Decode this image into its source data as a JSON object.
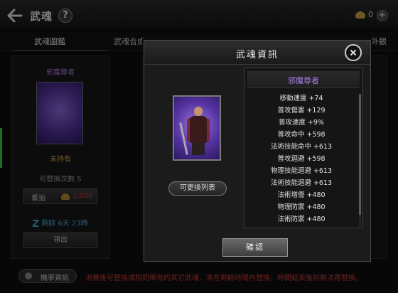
{
  "screen": {
    "title": "武魂",
    "help_label": "?",
    "currency_value": "0",
    "plus_label": "+"
  },
  "tabs": [
    {
      "label": "武魂圖鑑"
    },
    {
      "label": "武魂合成"
    },
    {
      "label": "外觀"
    }
  ],
  "left_panel": {
    "name": "邪魔尊者",
    "status": "未持有",
    "swap_count": "可替換次數 5",
    "redraw_label": "重抽",
    "redraw_cost": "1,000",
    "timer": "剩餘 6天 23時",
    "claim_label": "領出"
  },
  "bottom": {
    "probability_label": "機率資訊",
    "notice": "消費後可替換成相同稀有的其它武魂，未在剩餘時間內替換，時間結束後則無法再替換。"
  },
  "dialog": {
    "title": "武魂資訊",
    "list_button": "可更換列表",
    "confirm": "確認",
    "soul_name": "邪魔尊者",
    "stats": [
      {
        "name": "移動速度",
        "value": "+74"
      },
      {
        "name": "普攻傷害",
        "value": "+129"
      },
      {
        "name": "普攻速度",
        "value": "+9%"
      },
      {
        "name": "普攻命中",
        "value": "+598"
      },
      {
        "name": "法術技能命中",
        "value": "+613"
      },
      {
        "name": "普攻迴避",
        "value": "+598"
      },
      {
        "name": "物理技能迴避",
        "value": "+613"
      },
      {
        "name": "法術技能迴避",
        "value": "+613"
      },
      {
        "name": "法術增傷",
        "value": "+480"
      },
      {
        "name": "物理防禦",
        "value": "+480"
      },
      {
        "name": "法術防禦",
        "value": "+480"
      }
    ]
  },
  "colors": {
    "rarity_purple": "#a880e0",
    "warning_red": "#c83a3a",
    "timer_blue": "#4aa8d8",
    "status_gold": "#c8a040"
  },
  "icons": [
    "back-arrow-icon",
    "help-icon",
    "gold-icon",
    "plus-icon",
    "hourglass-icon",
    "probability-icon",
    "close-icon"
  ]
}
